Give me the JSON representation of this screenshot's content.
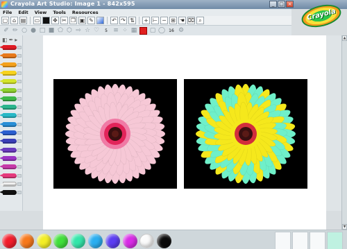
{
  "window": {
    "title": "Crayola Art Studio: Image 1 - 842x595",
    "minimize_glyph": "_",
    "maximize_glyph": "□",
    "close_glyph": "×"
  },
  "menu": {
    "items": [
      {
        "label": "File"
      },
      {
        "label": "Edit"
      },
      {
        "label": "View"
      },
      {
        "label": "Tools"
      },
      {
        "label": "Resources"
      }
    ]
  },
  "toolbar": {
    "size_value": "5",
    "opacity_value": "16",
    "ruler_labels": [
      "0",
      "1",
      "2"
    ]
  },
  "logo": {
    "text": "Crayola"
  },
  "crayons": [
    {
      "color": "#e01b24"
    },
    {
      "color": "#e8791a"
    },
    {
      "color": "#f4a11c"
    },
    {
      "color": "#f7d21e"
    },
    {
      "color": "#d4e52b"
    },
    {
      "color": "#8ed12f"
    },
    {
      "color": "#3db84a"
    },
    {
      "color": "#2bb58d"
    },
    {
      "color": "#28b8c6"
    },
    {
      "color": "#2a8fd6"
    },
    {
      "color": "#2b5fd0"
    },
    {
      "color": "#3b3fb8"
    },
    {
      "color": "#6b3bc0"
    },
    {
      "color": "#9b34c4"
    },
    {
      "color": "#c63aa8"
    },
    {
      "color": "#e53a7c"
    },
    {
      "color": "#f0f0f0"
    },
    {
      "color": "#111111"
    }
  ],
  "palette": {
    "swatches": [
      {
        "color": "#f21d2b"
      },
      {
        "color": "#f7791c"
      },
      {
        "color": "#f3ee25"
      },
      {
        "color": "#41e03c"
      },
      {
        "color": "#33e6aa"
      },
      {
        "color": "#2aaef0"
      },
      {
        "color": "#5b3df2"
      },
      {
        "color": "#d82be6"
      },
      {
        "color": "#fbfbfb"
      },
      {
        "color": "#0b0b0b"
      }
    ]
  },
  "images": [
    {
      "name": "original-gerbera",
      "petal_color": "#f6c8d6",
      "center_color": "#e2245a"
    },
    {
      "name": "edited-gerbera",
      "petal_color": "#6ff0c9",
      "accent_color": "#f5e81c",
      "center_color": "#d22d3c"
    }
  ]
}
